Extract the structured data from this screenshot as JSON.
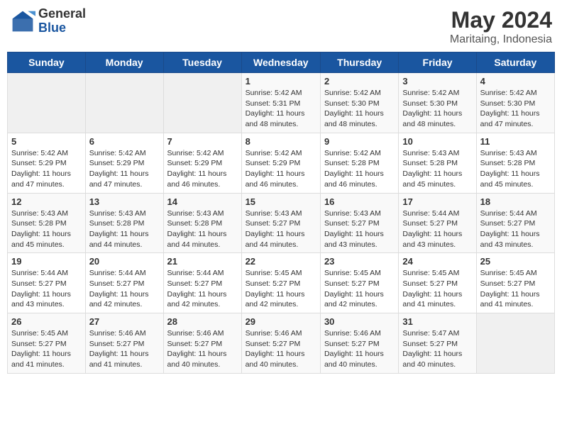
{
  "header": {
    "logo_general": "General",
    "logo_blue": "Blue",
    "month_year": "May 2024",
    "location": "Maritaing, Indonesia"
  },
  "days_of_week": [
    "Sunday",
    "Monday",
    "Tuesday",
    "Wednesday",
    "Thursday",
    "Friday",
    "Saturday"
  ],
  "weeks": [
    [
      {
        "day": "",
        "info": ""
      },
      {
        "day": "",
        "info": ""
      },
      {
        "day": "",
        "info": ""
      },
      {
        "day": "1",
        "info": "Sunrise: 5:42 AM\nSunset: 5:31 PM\nDaylight: 11 hours and 48 minutes."
      },
      {
        "day": "2",
        "info": "Sunrise: 5:42 AM\nSunset: 5:30 PM\nDaylight: 11 hours and 48 minutes."
      },
      {
        "day": "3",
        "info": "Sunrise: 5:42 AM\nSunset: 5:30 PM\nDaylight: 11 hours and 48 minutes."
      },
      {
        "day": "4",
        "info": "Sunrise: 5:42 AM\nSunset: 5:30 PM\nDaylight: 11 hours and 47 minutes."
      }
    ],
    [
      {
        "day": "5",
        "info": "Sunrise: 5:42 AM\nSunset: 5:29 PM\nDaylight: 11 hours and 47 minutes."
      },
      {
        "day": "6",
        "info": "Sunrise: 5:42 AM\nSunset: 5:29 PM\nDaylight: 11 hours and 47 minutes."
      },
      {
        "day": "7",
        "info": "Sunrise: 5:42 AM\nSunset: 5:29 PM\nDaylight: 11 hours and 46 minutes."
      },
      {
        "day": "8",
        "info": "Sunrise: 5:42 AM\nSunset: 5:29 PM\nDaylight: 11 hours and 46 minutes."
      },
      {
        "day": "9",
        "info": "Sunrise: 5:42 AM\nSunset: 5:28 PM\nDaylight: 11 hours and 46 minutes."
      },
      {
        "day": "10",
        "info": "Sunrise: 5:43 AM\nSunset: 5:28 PM\nDaylight: 11 hours and 45 minutes."
      },
      {
        "day": "11",
        "info": "Sunrise: 5:43 AM\nSunset: 5:28 PM\nDaylight: 11 hours and 45 minutes."
      }
    ],
    [
      {
        "day": "12",
        "info": "Sunrise: 5:43 AM\nSunset: 5:28 PM\nDaylight: 11 hours and 45 minutes."
      },
      {
        "day": "13",
        "info": "Sunrise: 5:43 AM\nSunset: 5:28 PM\nDaylight: 11 hours and 44 minutes."
      },
      {
        "day": "14",
        "info": "Sunrise: 5:43 AM\nSunset: 5:28 PM\nDaylight: 11 hours and 44 minutes."
      },
      {
        "day": "15",
        "info": "Sunrise: 5:43 AM\nSunset: 5:27 PM\nDaylight: 11 hours and 44 minutes."
      },
      {
        "day": "16",
        "info": "Sunrise: 5:43 AM\nSunset: 5:27 PM\nDaylight: 11 hours and 43 minutes."
      },
      {
        "day": "17",
        "info": "Sunrise: 5:44 AM\nSunset: 5:27 PM\nDaylight: 11 hours and 43 minutes."
      },
      {
        "day": "18",
        "info": "Sunrise: 5:44 AM\nSunset: 5:27 PM\nDaylight: 11 hours and 43 minutes."
      }
    ],
    [
      {
        "day": "19",
        "info": "Sunrise: 5:44 AM\nSunset: 5:27 PM\nDaylight: 11 hours and 43 minutes."
      },
      {
        "day": "20",
        "info": "Sunrise: 5:44 AM\nSunset: 5:27 PM\nDaylight: 11 hours and 42 minutes."
      },
      {
        "day": "21",
        "info": "Sunrise: 5:44 AM\nSunset: 5:27 PM\nDaylight: 11 hours and 42 minutes."
      },
      {
        "day": "22",
        "info": "Sunrise: 5:45 AM\nSunset: 5:27 PM\nDaylight: 11 hours and 42 minutes."
      },
      {
        "day": "23",
        "info": "Sunrise: 5:45 AM\nSunset: 5:27 PM\nDaylight: 11 hours and 42 minutes."
      },
      {
        "day": "24",
        "info": "Sunrise: 5:45 AM\nSunset: 5:27 PM\nDaylight: 11 hours and 41 minutes."
      },
      {
        "day": "25",
        "info": "Sunrise: 5:45 AM\nSunset: 5:27 PM\nDaylight: 11 hours and 41 minutes."
      }
    ],
    [
      {
        "day": "26",
        "info": "Sunrise: 5:45 AM\nSunset: 5:27 PM\nDaylight: 11 hours and 41 minutes."
      },
      {
        "day": "27",
        "info": "Sunrise: 5:46 AM\nSunset: 5:27 PM\nDaylight: 11 hours and 41 minutes."
      },
      {
        "day": "28",
        "info": "Sunrise: 5:46 AM\nSunset: 5:27 PM\nDaylight: 11 hours and 40 minutes."
      },
      {
        "day": "29",
        "info": "Sunrise: 5:46 AM\nSunset: 5:27 PM\nDaylight: 11 hours and 40 minutes."
      },
      {
        "day": "30",
        "info": "Sunrise: 5:46 AM\nSunset: 5:27 PM\nDaylight: 11 hours and 40 minutes."
      },
      {
        "day": "31",
        "info": "Sunrise: 5:47 AM\nSunset: 5:27 PM\nDaylight: 11 hours and 40 minutes."
      },
      {
        "day": "",
        "info": ""
      }
    ]
  ]
}
